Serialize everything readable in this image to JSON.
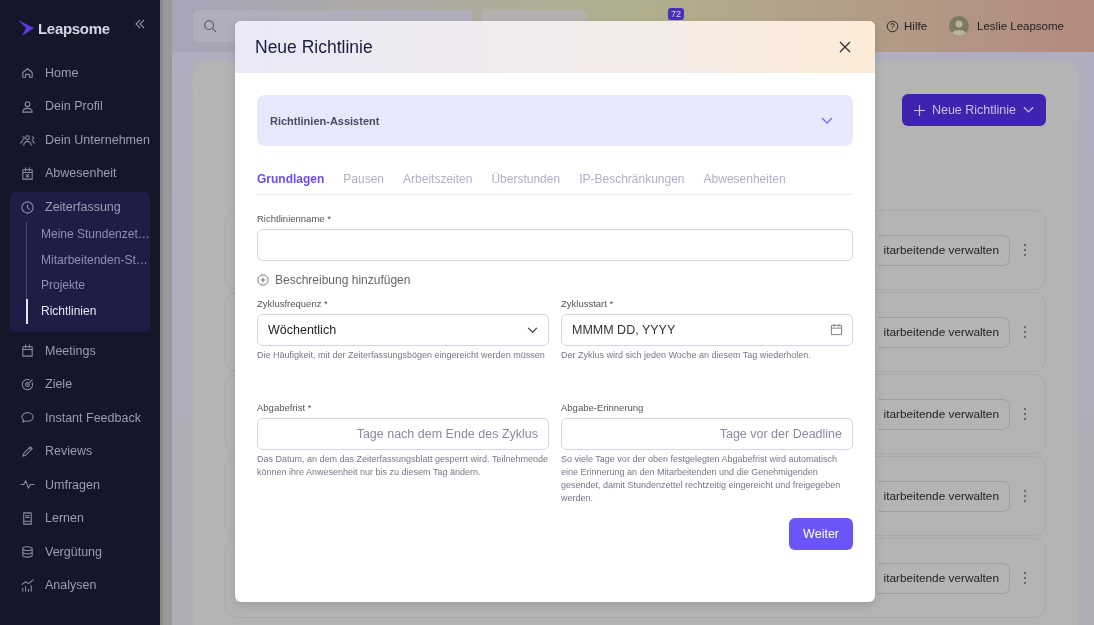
{
  "sidebar": {
    "logo": "Leapsome",
    "items": [
      {
        "label": "Home",
        "selected": false
      },
      {
        "label": "Dein Profil",
        "selected": false
      },
      {
        "label": "Dein Unternehmen",
        "selected": false
      },
      {
        "label": "Abwesenheit",
        "selected": false
      },
      {
        "label": "Zeiterfassung",
        "selected": false,
        "expanded": true,
        "children": [
          {
            "label": "Meine Stundenzet…",
            "selected": false
          },
          {
            "label": "Mitarbeitenden-St…",
            "selected": false
          },
          {
            "label": "Projekte",
            "selected": false
          },
          {
            "label": "Richtlinien",
            "selected": true
          }
        ]
      },
      {
        "label": "Meetings",
        "selected": false
      },
      {
        "label": "Ziele",
        "selected": false
      },
      {
        "label": "Instant Feedback",
        "selected": false
      },
      {
        "label": "Reviews",
        "selected": false
      },
      {
        "label": "Umfragen",
        "selected": false
      },
      {
        "label": "Lernen",
        "selected": false
      },
      {
        "label": "Vergütung",
        "selected": false
      },
      {
        "label": "Analysen",
        "selected": false
      }
    ]
  },
  "topbar": {
    "badge": "72",
    "help": "Hilfe",
    "user": "Leslie Leapsome"
  },
  "page": {
    "new_button": "Neue Richtlinie",
    "rows": [
      {
        "button": "itarbeitende verwalten"
      },
      {
        "button": "itarbeitende verwalten"
      },
      {
        "button": "itarbeitende verwalten"
      },
      {
        "button": "itarbeitende verwalten"
      },
      {
        "button": "itarbeitende verwalten"
      }
    ]
  },
  "modal": {
    "title": "Neue Richtlinie",
    "assistant": {
      "label": "Richtlinien-Assistent",
      "expanded": false
    },
    "tabs": [
      {
        "label": "Grundlagen",
        "selected": true
      },
      {
        "label": "Pausen",
        "selected": false
      },
      {
        "label": "Arbeitszeiten",
        "selected": false
      },
      {
        "label": "Überstunden",
        "selected": false
      },
      {
        "label": "IP-Beschränkungen",
        "selected": false
      },
      {
        "label": "Abwesenheiten",
        "selected": false
      }
    ],
    "name_field": {
      "label": "Richtlinienname *"
    },
    "add_description": "Beschreibung hinzufügen",
    "fields": [
      {
        "label": "Zyklusfrequenz *",
        "kind": "select",
        "value": "Wöchentlich",
        "help": "Die Häufigkeit, mit der Zeiterfassungsbögen eingereicht werden müssen"
      },
      {
        "label": "Zyklusstart *",
        "kind": "date",
        "placeholder": "MMMM DD, YYYY",
        "help": "Der Zyklus wird sich jeden Woche an diesem Tag wiederholen."
      },
      {
        "label": "Abgabefrist *",
        "kind": "number",
        "placeholder": "Tage nach dem Ende des Zyklus",
        "help": "Das Datum, an dem das Zeiterfassungsblatt gesperrt wird. Teilnehmende können ihre Anwesenheit nur bis zu diesem Tag ändern."
      },
      {
        "label": "Abgabe-Erinnerung",
        "kind": "number",
        "placeholder": "Tage vor der Deadline",
        "help": "So viele Tage vor der oben festgelegten Abgabefrist wird automatisch eine Erinnerung an den Mitarbeitenden und die Genehmigenden gesendet, damit Stundenzettel rechtzeitig eingereicht und freigegeben werden."
      }
    ],
    "submit": "Weiter"
  }
}
